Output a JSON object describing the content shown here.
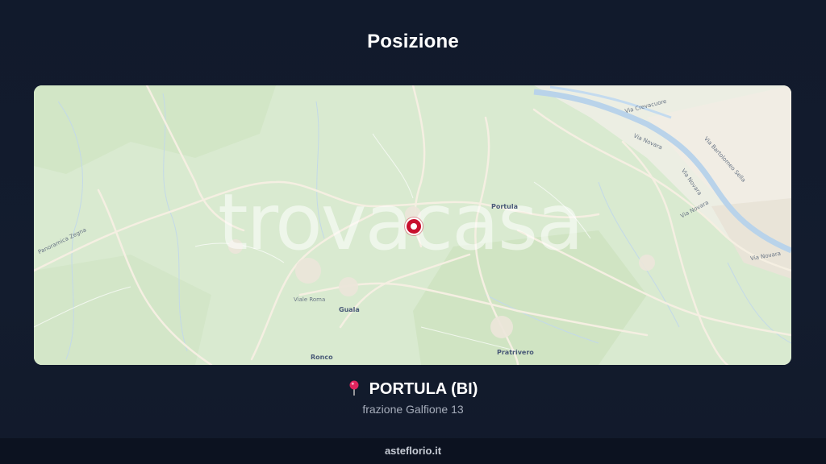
{
  "title": "Posizione",
  "map": {
    "watermark": "trovacasa",
    "places": {
      "portula": "Portula",
      "guala": "Guala",
      "ronco": "Ronco",
      "pratrivero": "Pratrivero"
    },
    "roads": {
      "via_roma": "Viale Roma",
      "panoramica_zegna": "Panoramica Zegna",
      "via_crevacuore": "Via Crevacuore",
      "via_novara_1": "Via Novara",
      "via_novara_2": "Via Novara",
      "via_novara_3": "Via Novara",
      "via_novara_4": "Via Novara",
      "via_bartolomeo_sella": "Via Bartolomeo Sella"
    },
    "colors": {
      "land": "#d9ead0",
      "forest": "#cfe3c3",
      "road": "#f3ede0",
      "river": "#b9d3ea",
      "urban": "#efe9e0",
      "marker": "#c8102e"
    }
  },
  "location": {
    "name": "PORTULA (BI)",
    "address": "frazione Galfione 13",
    "icon": "map-pin-icon"
  },
  "footer": "asteflorio.it"
}
